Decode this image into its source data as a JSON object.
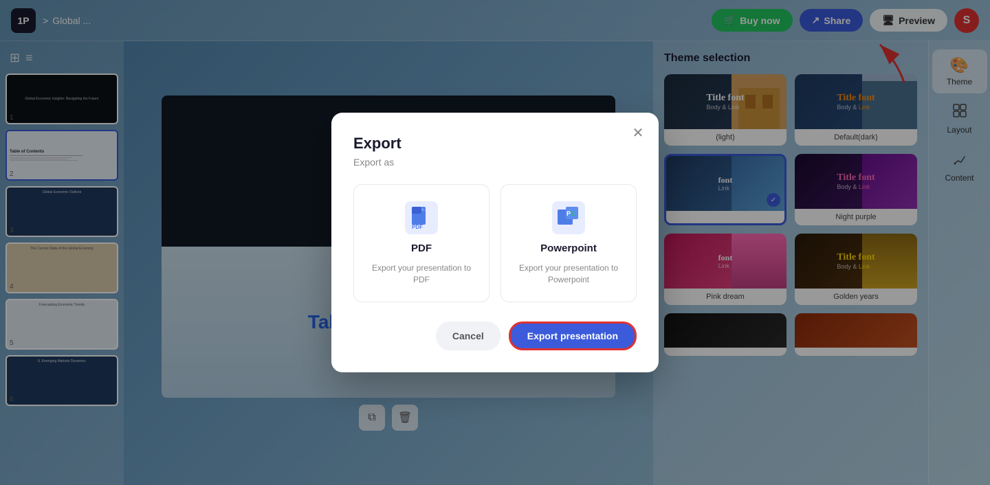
{
  "topbar": {
    "logo_text": "1P",
    "breadcrumb_sep": ">",
    "page_name": "Global ...",
    "buy_label": "Buy now",
    "share_label": "Share",
    "preview_label": "Preview",
    "avatar_letter": "S"
  },
  "sidebar": {
    "slides": [
      {
        "num": "1",
        "type": "dark"
      },
      {
        "num": "2",
        "type": "light",
        "active": true
      },
      {
        "num": "3",
        "type": "blue"
      },
      {
        "num": "4",
        "type": "light"
      },
      {
        "num": "5",
        "type": "light"
      },
      {
        "num": "6",
        "type": "blue"
      }
    ]
  },
  "canvas": {
    "slide_title": "Table of Contents"
  },
  "theme_panel": {
    "title": "Theme selection",
    "themes": [
      {
        "id": "default-light",
        "name": "(light)",
        "style": "dark",
        "font": "Title font",
        "body": "Body & Link"
      },
      {
        "id": "default-dark",
        "name": "Default(dark)",
        "style": "default-dark",
        "font": "Title font",
        "body": "Body & Link",
        "has_img": true
      },
      {
        "id": "blue-selected",
        "name": "",
        "style": "blue-selected",
        "font": "font",
        "body": "Link",
        "selected": true
      },
      {
        "id": "night-purple",
        "name": "Night purple",
        "style": "purple",
        "font": "Title font",
        "body": "Body & Link"
      },
      {
        "id": "pink-dream",
        "name": "Pink dream",
        "style": "pink",
        "font": "font",
        "body": "Link"
      },
      {
        "id": "golden-years",
        "name": "Golden years",
        "style": "golden",
        "font": "Title font",
        "body": "Body & Link",
        "has_img": true
      },
      {
        "id": "dark-bottom1",
        "name": "",
        "style": "dark1",
        "font": "",
        "body": ""
      },
      {
        "id": "orange-bottom",
        "name": "",
        "style": "orange",
        "font": "",
        "body": ""
      }
    ]
  },
  "right_sidebar": {
    "items": [
      {
        "id": "theme",
        "label": "Theme",
        "icon": "🎨",
        "active": true
      },
      {
        "id": "layout",
        "label": "Layout",
        "icon": "▦"
      },
      {
        "id": "content",
        "label": "Content",
        "icon": "✏️"
      }
    ]
  },
  "modal": {
    "title": "Export",
    "subtitle": "Export as",
    "close_aria": "close",
    "options": [
      {
        "id": "pdf",
        "icon": "📄",
        "label": "PDF",
        "description": "Export your presentation to PDF"
      },
      {
        "id": "powerpoint",
        "icon": "📊",
        "label": "Powerpoint",
        "description": "Export your presentation to Powerpoint"
      }
    ],
    "cancel_label": "Cancel",
    "export_label": "Export presentation"
  }
}
